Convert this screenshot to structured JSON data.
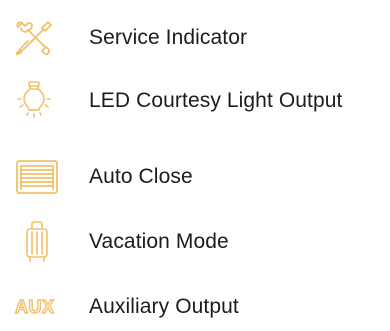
{
  "colors": {
    "icon": "#f2c06a",
    "text": "#1c1c1c",
    "background": "#ffffff"
  },
  "features": [
    {
      "label": "Service Indicator",
      "icon": "wrench-screwdriver-icon"
    },
    {
      "label": "LED Courtesy Light Output",
      "icon": "light-bulb-icon"
    },
    {
      "label": "Auto Close",
      "icon": "garage-door-icon"
    },
    {
      "label": "Vacation Mode",
      "icon": "suitcase-icon"
    },
    {
      "label": "Auxiliary Output",
      "icon": "aux-icon",
      "icon_text": "AUX"
    }
  ]
}
